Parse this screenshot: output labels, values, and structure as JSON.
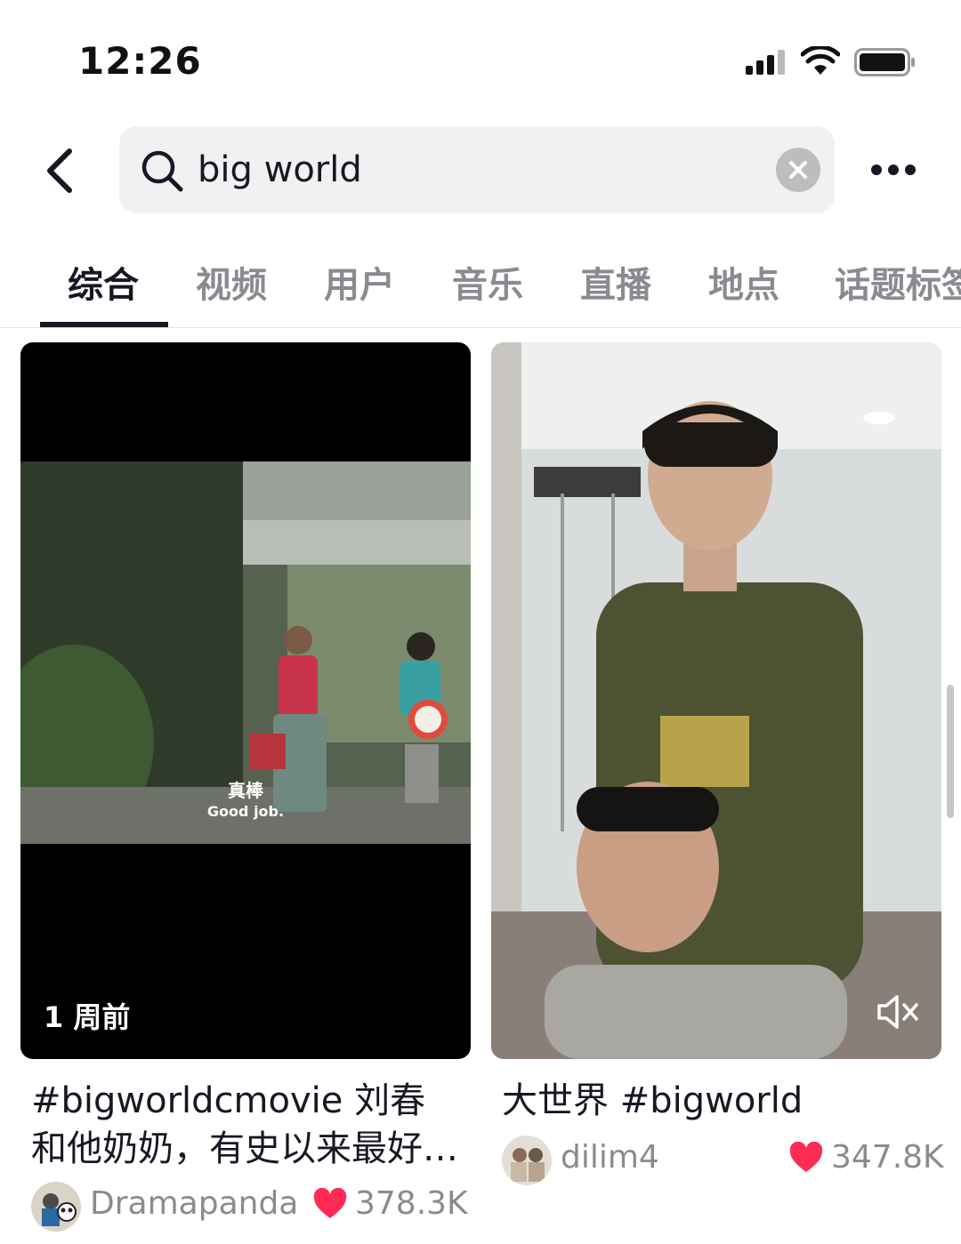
{
  "status_bar": {
    "time": "12:26"
  },
  "header": {
    "search_query": "big world"
  },
  "tabs": [
    {
      "label": "综合",
      "active": true
    },
    {
      "label": "视频",
      "active": false
    },
    {
      "label": "用户",
      "active": false
    },
    {
      "label": "音乐",
      "active": false
    },
    {
      "label": "直播",
      "active": false
    },
    {
      "label": "地点",
      "active": false
    },
    {
      "label": "话题标签",
      "active": false
    }
  ],
  "results": [
    {
      "time_ago": "1 周前",
      "video_subtitle_zh": "真棒",
      "video_subtitle_en": "Good job.",
      "caption": "#bigworldcmovie 刘春和他奶奶，有史以来最好…",
      "author": "Dramapanda",
      "likes": "378.3K"
    },
    {
      "caption": "大世界 #bigworld",
      "author": "dilim4",
      "likes": "347.8K",
      "muted": true
    }
  ],
  "colors": {
    "accent_like": "#fe2c55",
    "text_primary": "#161823",
    "text_secondary": "#8a8b91",
    "search_bg": "#f1f1f2"
  }
}
